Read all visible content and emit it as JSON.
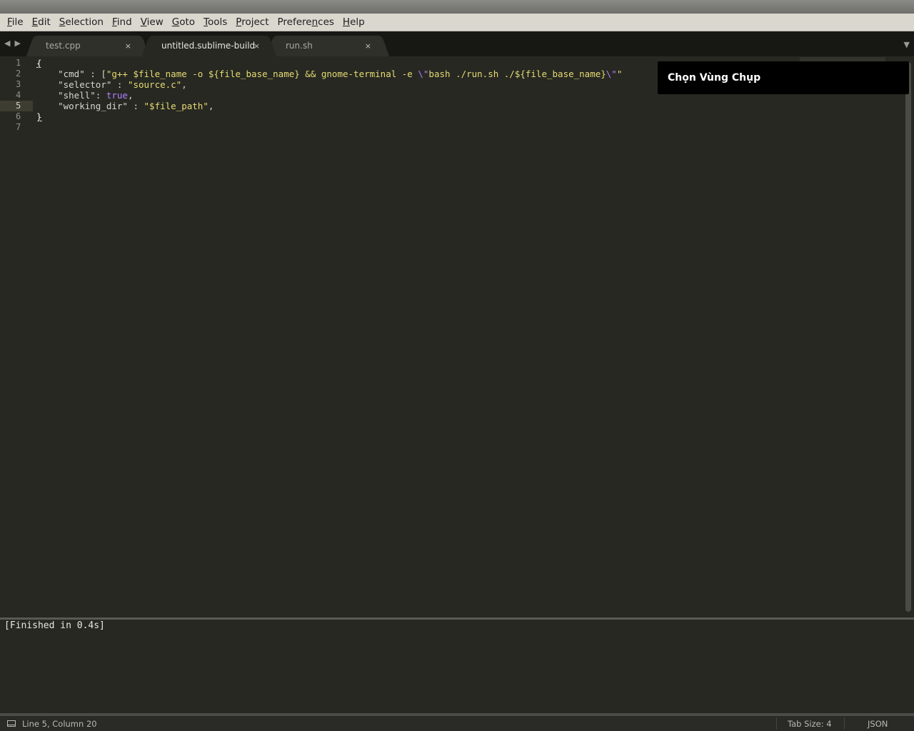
{
  "menubar": {
    "items": [
      {
        "label": "File",
        "underline": "F",
        "rest": "ile"
      },
      {
        "label": "Edit",
        "underline": "E",
        "rest": "dit"
      },
      {
        "label": "Selection",
        "underline": "S",
        "rest": "election"
      },
      {
        "label": "Find",
        "underline": "F",
        "rest": "ind"
      },
      {
        "label": "View",
        "underline": "V",
        "rest": "iew"
      },
      {
        "label": "Goto",
        "underline": "G",
        "rest": "oto"
      },
      {
        "label": "Tools",
        "underline": "T",
        "rest": "ools"
      },
      {
        "label": "Project",
        "underline": "P",
        "rest": "roject"
      },
      {
        "label": "Preferences",
        "pre": "Prefere",
        "underline": "n",
        "rest": "ces"
      },
      {
        "label": "Help",
        "underline": "H",
        "rest": "elp"
      }
    ]
  },
  "tabs": [
    {
      "label": "test.cpp",
      "close": "×",
      "active": false
    },
    {
      "label": "untitled.sublime-build",
      "close": "×",
      "active": true
    },
    {
      "label": "run.sh",
      "close": "×",
      "active": false
    }
  ],
  "nav": {
    "back": "◀",
    "forward": "▶",
    "tab_menu": "▼"
  },
  "editor": {
    "line_numbers": [
      "1",
      "2",
      "3",
      "4",
      "5",
      "6",
      "7"
    ],
    "current_line": 5,
    "lines": [
      "{",
      "    \"cmd\" : [\"g++ $file_name -o ${file_base_name} && gnome-terminal -e \\\"bash ./run.sh ./${file_base_name}\\\"\"",
      "    \"selector\" : \"source.c\",",
      "    \"shell\": true,",
      "    \"working_dir\" : \"$file_path\",",
      "}",
      ""
    ]
  },
  "notification": {
    "text": "Chọn Vùng Chụp"
  },
  "output": {
    "text": "[Finished in 0.4s]"
  },
  "statusbar": {
    "position": "Line 5, Column 20",
    "tab_size": "Tab Size: 4",
    "syntax": "JSON"
  },
  "colors": {
    "background": "#272822",
    "string": "#e6db74",
    "constant": "#ae81ff",
    "menubar": "#dad7cf"
  }
}
